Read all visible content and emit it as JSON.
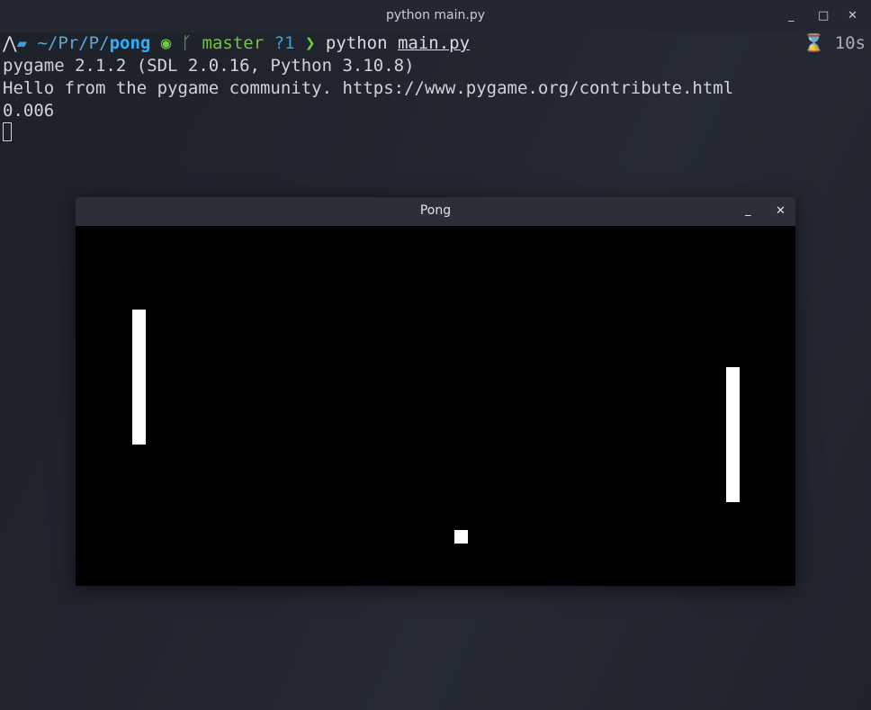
{
  "terminal": {
    "title": "python main.py",
    "minimize_label": "_",
    "maximize_label": "□",
    "close_label": "✕",
    "prompt": {
      "path_prefix": "~/Pr/P/",
      "path_current": "pong",
      "branch": "master",
      "untracked": "?1",
      "command": "python",
      "argument": "main.py"
    },
    "duration": "10s",
    "output": [
      "pygame 2.1.2 (SDL 2.0.16, Python 3.10.8)",
      "Hello from the pygame community. https://www.pygame.org/contribute.html",
      "0.006"
    ]
  },
  "pong_window": {
    "title": "Pong",
    "minimize_label": "_",
    "close_label": "✕"
  }
}
